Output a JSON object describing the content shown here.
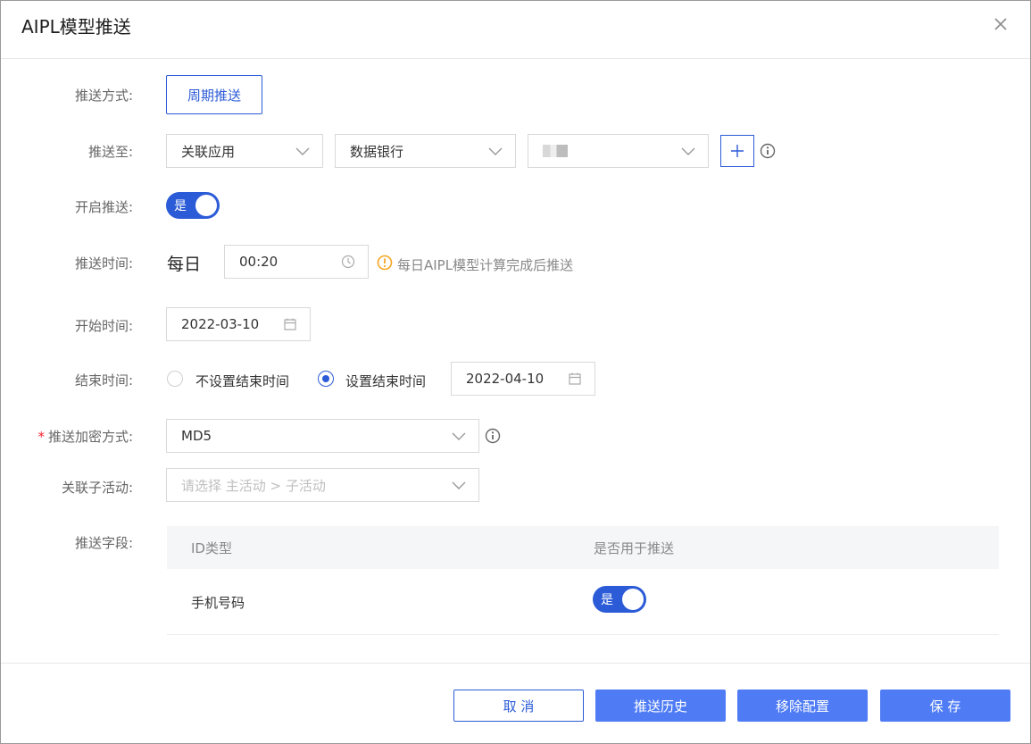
{
  "dialog": {
    "title": "AIPL模型推送"
  },
  "labels": {
    "push_mode": "推送方式:",
    "push_to": "推送至:",
    "enable_push": "开启推送:",
    "push_time": "推送时间:",
    "start_time": "开始时间:",
    "end_time": "结束时间:",
    "encryption": "推送加密方式:",
    "sub_activity": "关联子活动:",
    "fields": "推送字段:"
  },
  "push_mode": {
    "button_label": "周期推送"
  },
  "push_to": {
    "select1": "关联应用",
    "select2": "数据银行",
    "select3": ""
  },
  "enable_push": {
    "switch_text": "是"
  },
  "push_time": {
    "frequency": "每日",
    "time_value": "00:20",
    "hint": "每日AIPL模型计算完成后推送"
  },
  "start_time": {
    "value": "2022-03-10"
  },
  "end_time": {
    "option_none": "不设置结束时间",
    "option_set": "设置结束时间",
    "value": "2022-04-10"
  },
  "encryption": {
    "required_mark": "*",
    "value": "MD5"
  },
  "sub_activity": {
    "placeholder": "请选择 主活动 > 子活动"
  },
  "fields_table": {
    "headers": [
      "ID类型",
      "是否用于推送"
    ],
    "rows": [
      {
        "id_type": "手机号码",
        "switch_text": "是"
      }
    ]
  },
  "footer": {
    "cancel": "取 消",
    "history": "推送历史",
    "remove": "移除配置",
    "save": "保 存"
  },
  "colors": {
    "primary": "#2b5bd7",
    "button_primary": "#4f7cf5",
    "warning": "#f5a623",
    "required": "#f5222d"
  }
}
